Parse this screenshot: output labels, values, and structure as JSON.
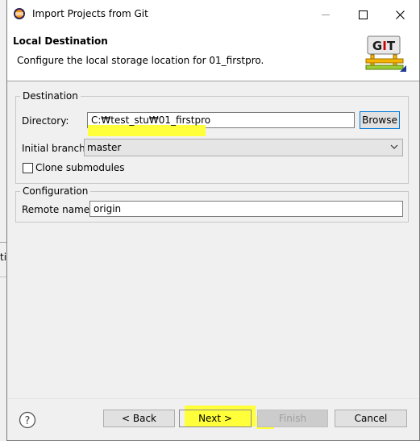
{
  "background": {
    "fragment": "ti"
  },
  "window": {
    "title": "Import Projects from Git",
    "controls": {
      "minimize": "—",
      "maximize": "☐",
      "close": "✕"
    }
  },
  "header": {
    "title": "Local Destination",
    "description": "Configure the local storage location for 01_firstpro.",
    "logo_text": "GIT"
  },
  "destination": {
    "group_label": "Destination",
    "directory_label": "Directory:",
    "directory_value": "C:₩test_stu₩01_firstpro",
    "browse_label": "Browse",
    "branch_label": "Initial branch:",
    "branch_value": "master",
    "clone_submodules_label": "Clone submodules",
    "clone_submodules_checked": false
  },
  "configuration": {
    "group_label": "Configuration",
    "remote_label": "Remote name:",
    "remote_value": "origin"
  },
  "footer": {
    "help_glyph": "?",
    "back_label": "< Back",
    "next_label": "Next >",
    "finish_label": "Finish",
    "cancel_label": "Cancel"
  },
  "colors": {
    "highlight": "#ffff3a",
    "focus_border": "#0078d7"
  }
}
